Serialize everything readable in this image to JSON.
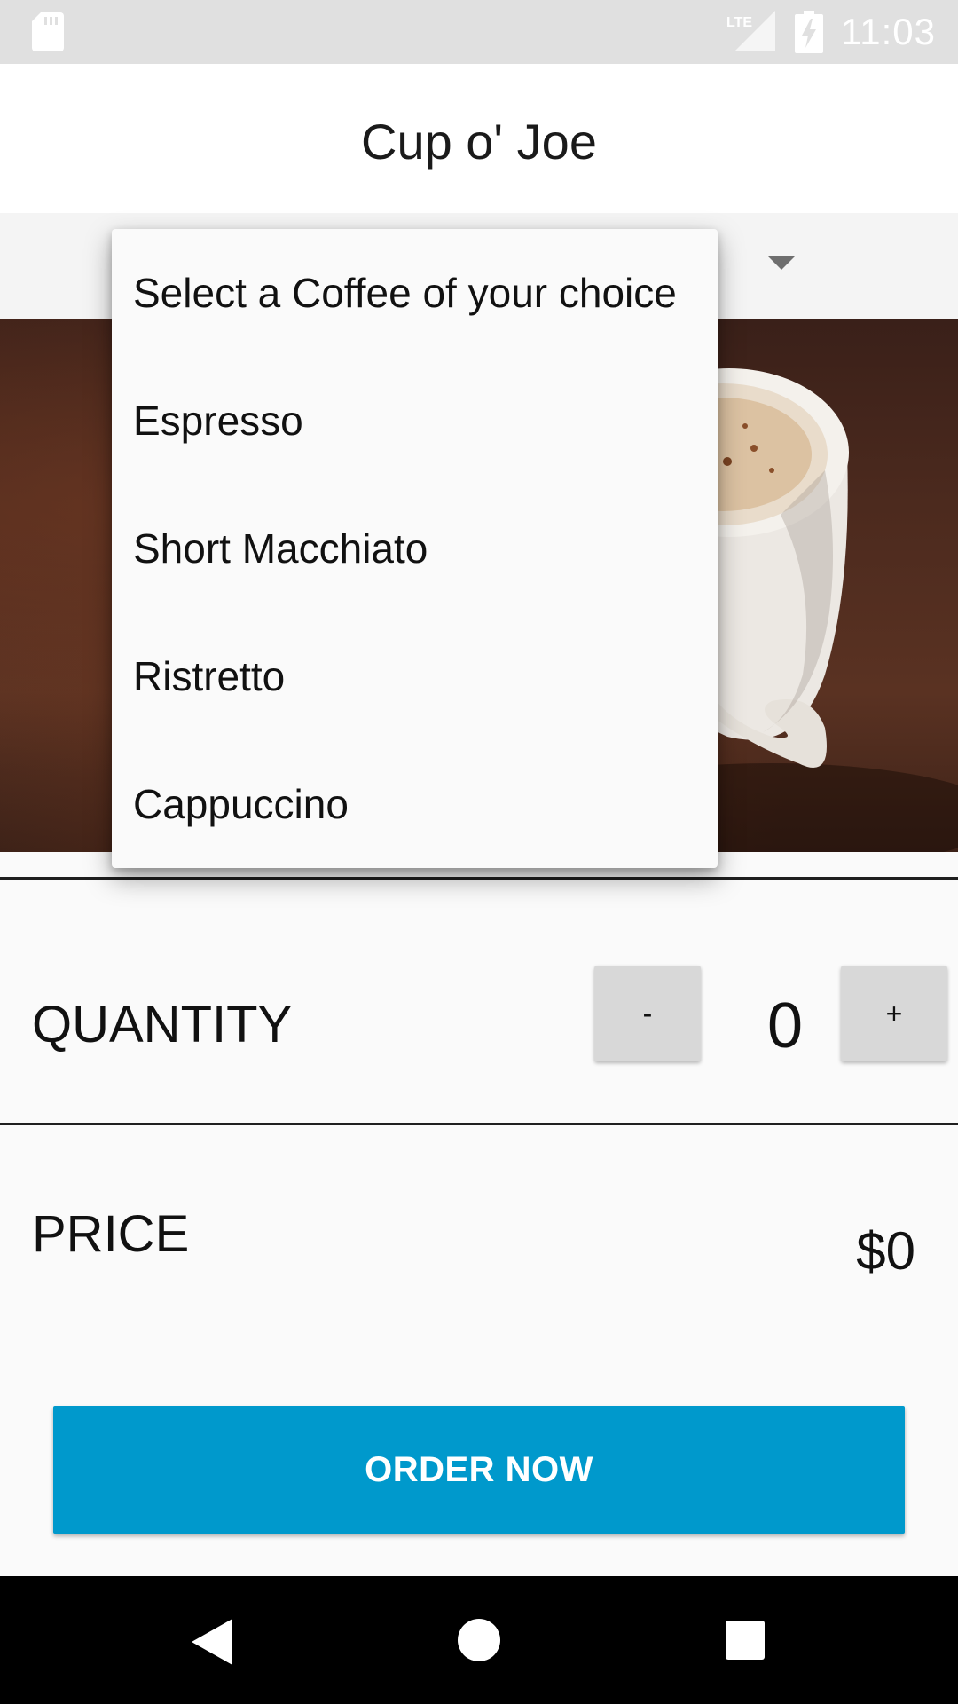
{
  "status_bar": {
    "time": "11:03",
    "network_label": "LTE",
    "icons": [
      "sd-card-icon",
      "lte-signal-icon",
      "battery-charging-icon"
    ]
  },
  "app_bar": {
    "title": "Cup o' Joe"
  },
  "coffee_spinner": {
    "dropdown_open": true,
    "options": [
      "Select a Coffee of your choice",
      "Espresso",
      "Short Macchiato",
      "Ristretto",
      "Cappuccino"
    ]
  },
  "quantity": {
    "label": "QUANTITY",
    "decrement_label": "-",
    "value": "0",
    "increment_label": "+"
  },
  "price": {
    "label": "PRICE",
    "value": "$0"
  },
  "order_button": {
    "label": "ORDER NOW",
    "color": "#0099cc"
  },
  "nav_bar": {
    "icons": [
      "back-icon",
      "home-icon",
      "recents-icon"
    ]
  }
}
